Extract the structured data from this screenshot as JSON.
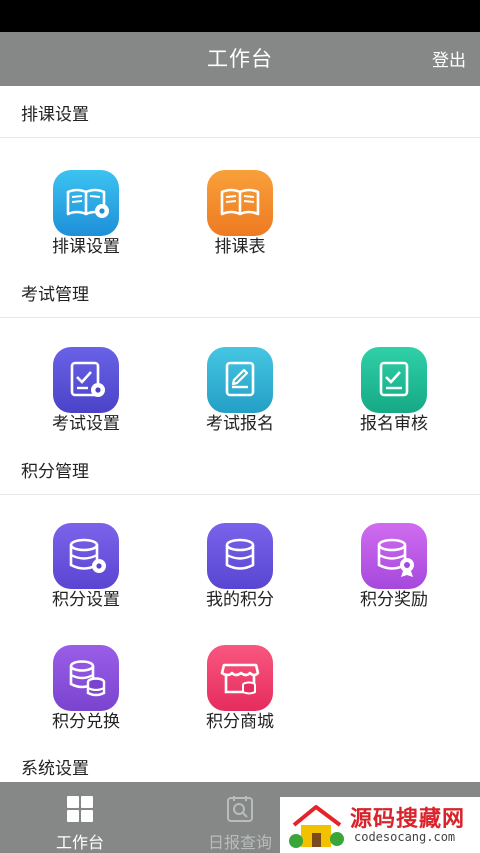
{
  "header": {
    "title": "工作台",
    "logout_label": "登出"
  },
  "sections": [
    {
      "title": "排课设置",
      "items": [
        {
          "label": "排课设置",
          "icon": "book-settings-icon",
          "color": "#29a8e6"
        },
        {
          "label": "排课表",
          "icon": "book-icon",
          "color": "#f08a2c"
        }
      ]
    },
    {
      "title": "考试管理",
      "items": [
        {
          "label": "考试设置",
          "icon": "checklist-settings-icon",
          "color": "#5b53d8"
        },
        {
          "label": "考试报名",
          "icon": "edit-document-icon",
          "color": "#33b6d6"
        },
        {
          "label": "报名审核",
          "icon": "checklist-icon",
          "color": "#1fbf9a"
        }
      ]
    },
    {
      "title": "积分管理",
      "items": [
        {
          "label": "积分设置",
          "icon": "database-settings-icon",
          "color": "#6d55df"
        },
        {
          "label": "我的积分",
          "icon": "database-icon",
          "color": "#6a57df"
        },
        {
          "label": "积分奖励",
          "icon": "database-award-icon",
          "color": "#c05ae8"
        },
        {
          "label": "积分兑换",
          "icon": "coins-stack-icon",
          "color": "#8a4fd8"
        },
        {
          "label": "积分商城",
          "icon": "store-icon",
          "color": "#f0416e"
        }
      ]
    },
    {
      "title": "系统设置"
    }
  ],
  "tabs": [
    {
      "label": "工作台",
      "icon": "grid-icon",
      "active": true
    },
    {
      "label": "日报查询",
      "icon": "search-report-icon",
      "active": false
    }
  ],
  "watermark": {
    "brand": "源码搜藏网",
    "domain": "codesocang.com"
  }
}
